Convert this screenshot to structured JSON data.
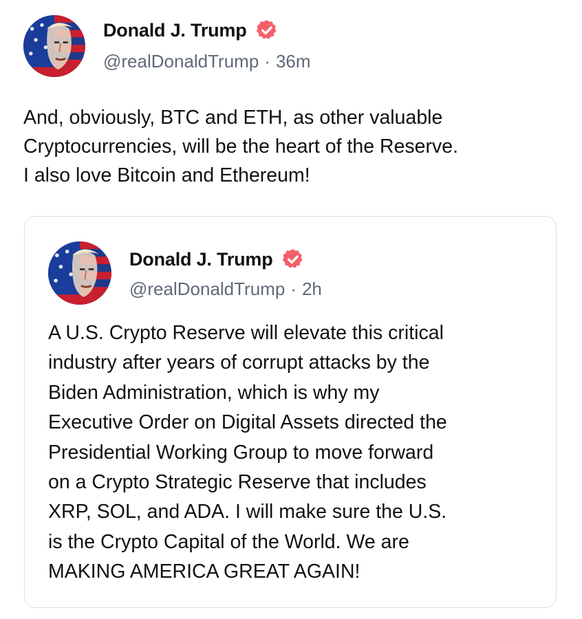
{
  "post": {
    "author": {
      "display_name": "Donald J. Trump",
      "handle": "@realDonaldTrump",
      "verified": true,
      "avatar_icon": "flag-portrait-avatar"
    },
    "separator": "·",
    "time": "36m",
    "body": "And, obviously, BTC and ETH, as other valuable\nCryptocurrencies, will be the heart of the Reserve.\nI also love Bitcoin and Ethereum!"
  },
  "quoted_post": {
    "author": {
      "display_name": "Donald J. Trump",
      "handle": "@realDonaldTrump",
      "verified": true,
      "avatar_icon": "flag-portrait-avatar"
    },
    "separator": "·",
    "time": "2h",
    "body": "A U.S. Crypto Reserve will elevate this critical\nindustry after years of corrupt attacks by the\nBiden Administration, which is why my\nExecutive Order on Digital Assets directed the\nPresidential Working Group to move forward\non a Crypto Strategic Reserve that includes\nXRP, SOL, and ADA. I will make sure the U.S.\nis the Crypto Capital of the World. We are\nMAKING AMERICA GREAT AGAIN!"
  },
  "colors": {
    "verified_badge": "#f4606a",
    "text": "#111111",
    "meta_text": "#606a77",
    "card_border": "#dcdfe4"
  }
}
